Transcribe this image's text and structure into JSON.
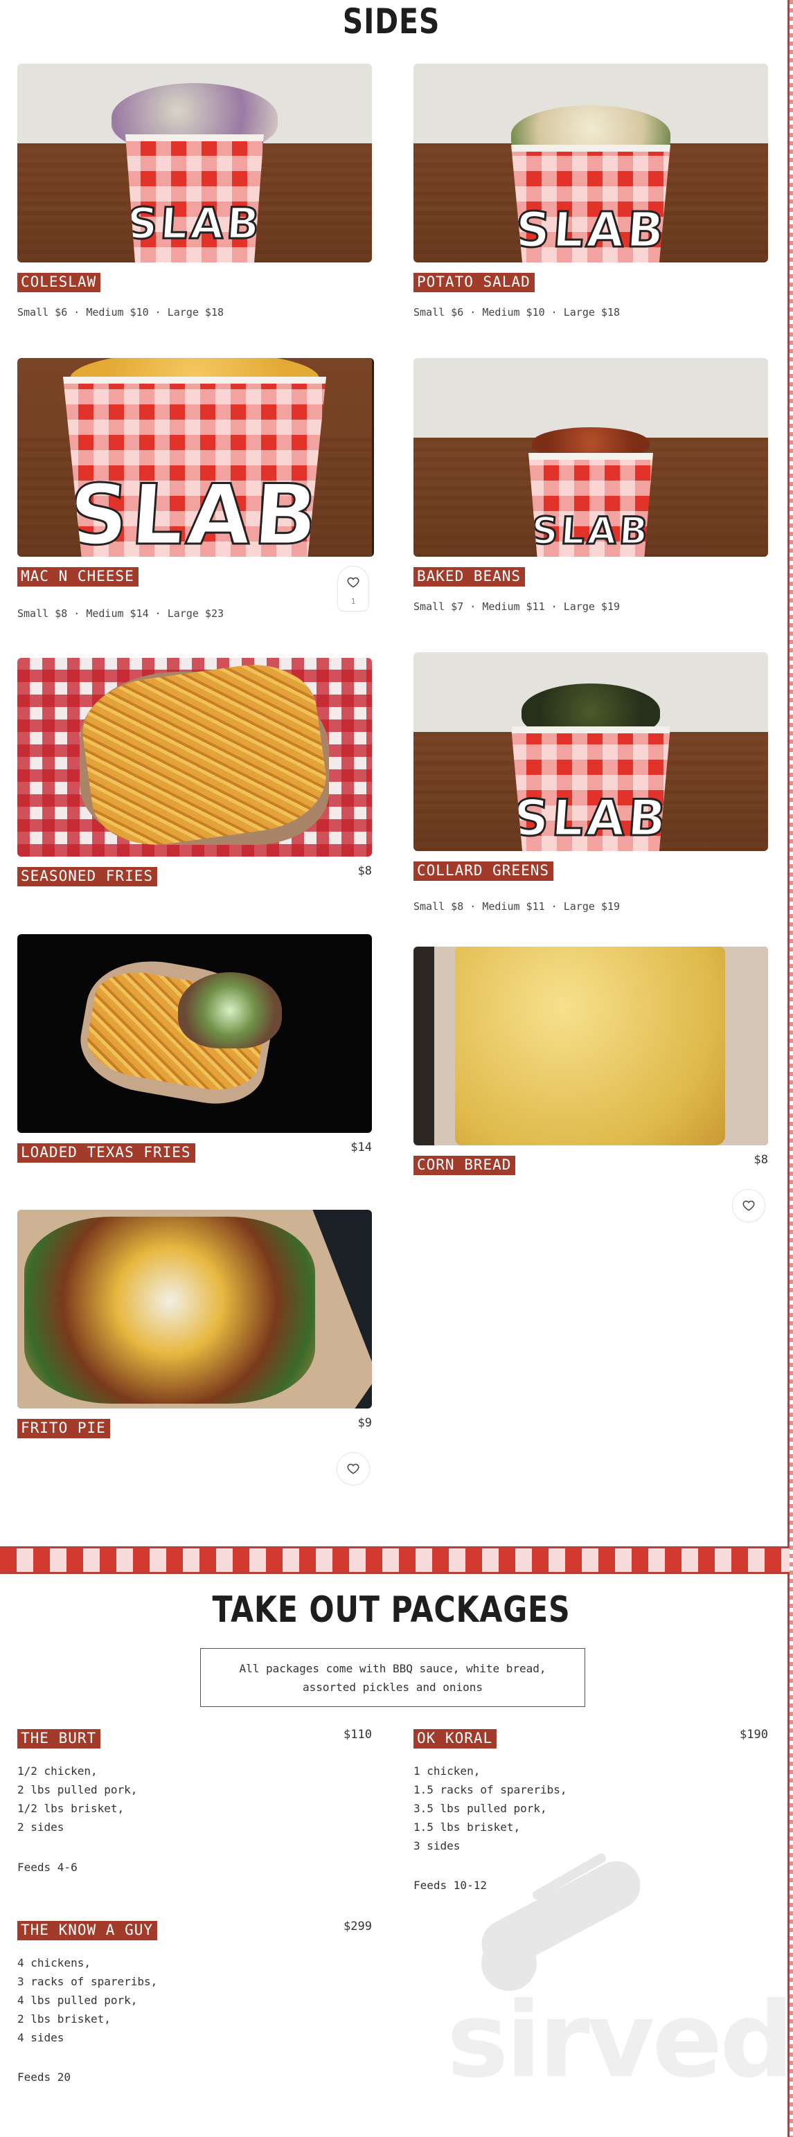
{
  "sides": {
    "title": "SIDES",
    "items": [
      {
        "name": "COLESLAW",
        "sizes": "Small $6 · Medium $10 · Large $18"
      },
      {
        "name": "POTATO SALAD",
        "sizes": "Small $6 · Medium $10 · Large $18"
      },
      {
        "name": "MAC N CHEESE",
        "sizes": "Small $8 · Medium $14 · Large $23",
        "likes": "1"
      },
      {
        "name": "BAKED BEANS",
        "sizes": "Small $7 · Medium $11 · Large $19"
      },
      {
        "name": "SEASONED FRIES",
        "price": "$8"
      },
      {
        "name": "COLLARD GREENS",
        "sizes": "Small $8 · Medium $11 · Large $19"
      },
      {
        "name": "LOADED TEXAS FRIES",
        "price": "$14"
      },
      {
        "name": "CORN BREAD",
        "price": "$8"
      },
      {
        "name": "FRITO PIE",
        "price": "$9"
      }
    ],
    "cup_text": "SLAB"
  },
  "takeout": {
    "title": "TAKE OUT PACKAGES",
    "note": "All packages come with BBQ sauce, white bread,\nassorted pickles and onions",
    "packages": [
      {
        "name": "THE BURT",
        "price": "$110",
        "lines": "1/2 chicken,\n2 lbs pulled pork,\n1/2 lbs brisket,\n2 sides",
        "feeds": "Feeds 4-6"
      },
      {
        "name": "OK KORAL",
        "price": "$190",
        "lines": "1 chicken,\n1.5 racks of spareribs,\n3.5 lbs pulled pork,\n1.5 lbs brisket,\n3 sides",
        "feeds": "Feeds 10-12"
      },
      {
        "name": "THE KNOW A GUY",
        "price": "$299",
        "lines": "4 chickens,\n3 racks of spareribs,\n4 lbs pulled pork,\n2 lbs brisket,\n4 sides",
        "feeds": "Feeds 20"
      }
    ]
  },
  "watermark": {
    "brand": "sirved"
  },
  "colors": {
    "accent": "#a23b2a",
    "border": "#b0423a",
    "checker_red": "#d33a2f"
  },
  "icons": {
    "favorite": "heart-outline-icon"
  }
}
